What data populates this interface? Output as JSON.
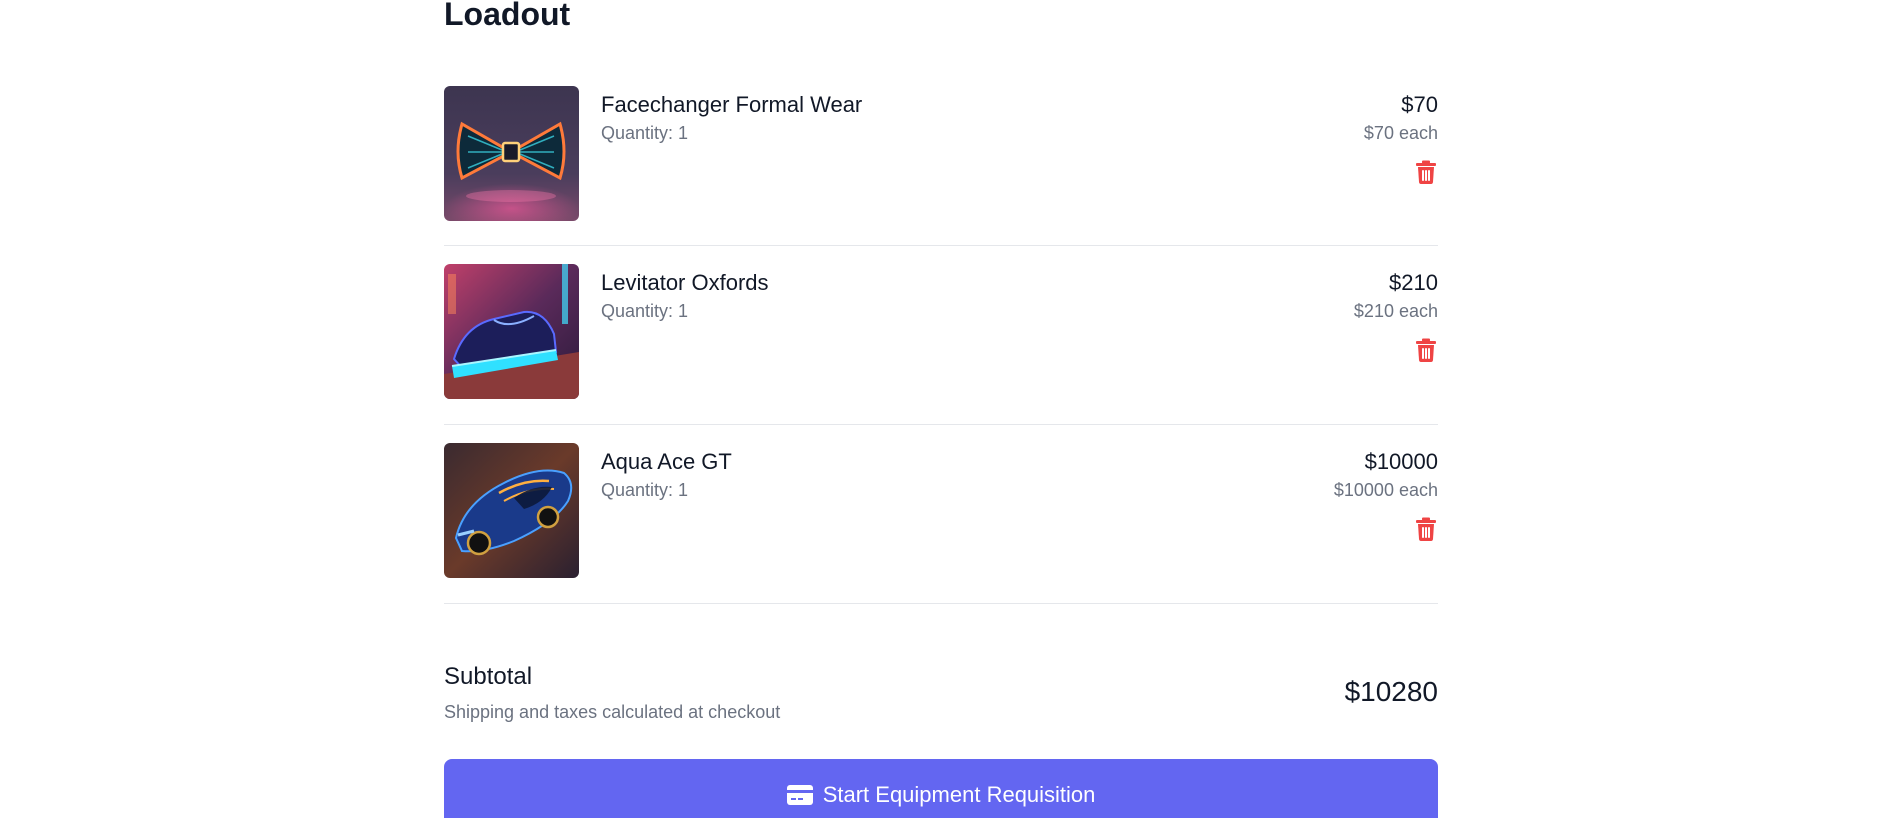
{
  "page": {
    "title": "Loadout"
  },
  "items": [
    {
      "name": "Facechanger Formal Wear",
      "quantity": "Quantity: 1",
      "price": "$70",
      "each": "$70 each",
      "image_icon": "neon-bowtie-image",
      "remove_icon": "trash-icon"
    },
    {
      "name": "Levitator Oxfords",
      "quantity": "Quantity: 1",
      "price": "$210",
      "each": "$210 each",
      "image_icon": "neon-shoe-image",
      "remove_icon": "trash-icon"
    },
    {
      "name": "Aqua Ace GT",
      "quantity": "Quantity: 1",
      "price": "$10000",
      "each": "$10000 each",
      "image_icon": "neon-car-image",
      "remove_icon": "trash-icon"
    }
  ],
  "summary": {
    "subtotal_label": "Subtotal",
    "subtotal_note": "Shipping and taxes calculated at checkout",
    "subtotal_value": "$10280"
  },
  "checkout": {
    "label": "Start Equipment Requisition",
    "icon": "credit-card-icon"
  },
  "colors": {
    "accent": "#6366f1",
    "danger": "#ef4444",
    "muted_text": "#6b7280",
    "divider": "#e5e7eb"
  }
}
